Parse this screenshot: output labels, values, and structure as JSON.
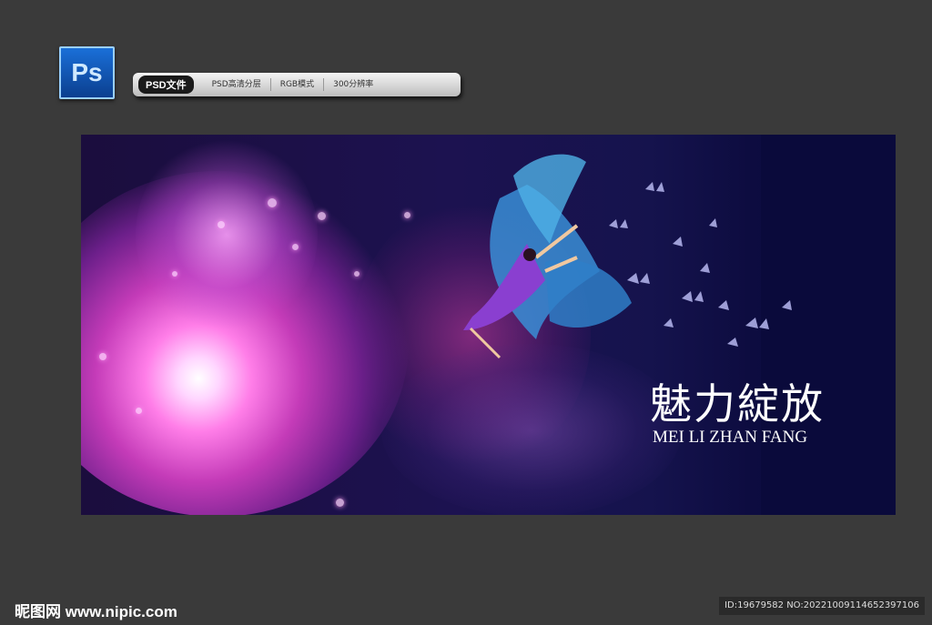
{
  "header": {
    "ps_logo": "Ps",
    "tags": {
      "main": "PSD文件",
      "items": [
        "PSD高清分层",
        "RGB模式",
        "300分辨率"
      ]
    }
  },
  "banner": {
    "title_cn": "魅力綻放",
    "title_en": "MEI LI ZHAN FANG",
    "colors": {
      "flower": "#e65fd8",
      "background": "#0a0a3b",
      "fabric": "#3da0d8"
    }
  },
  "footer": {
    "site": "昵图网 www.nipic.com",
    "id_text": "ID:19679582 NO:20221009114652397106"
  }
}
